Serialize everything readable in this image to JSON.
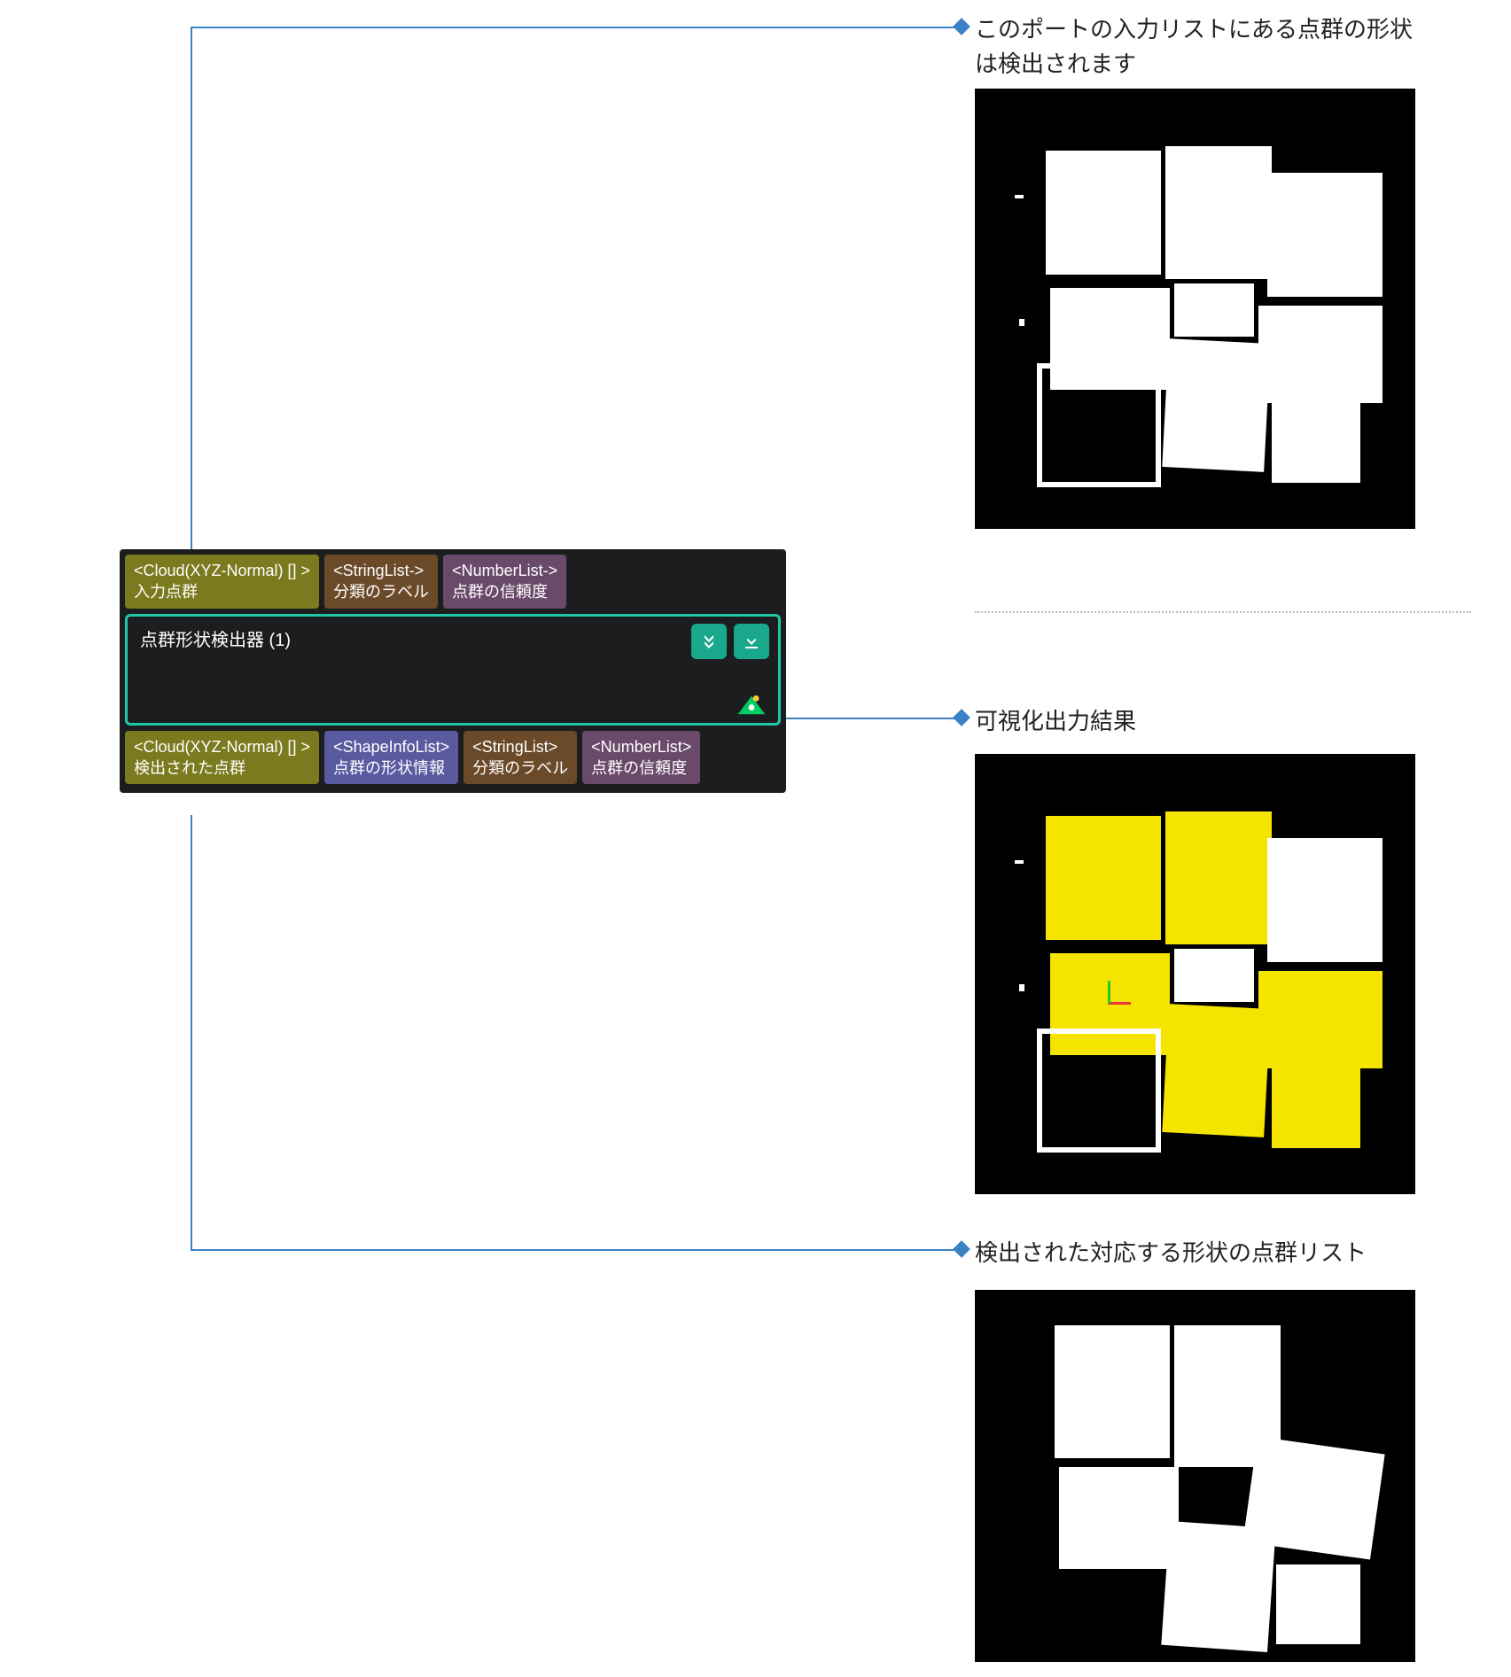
{
  "node": {
    "title": "点群形状検出器 (1)",
    "inputs": [
      {
        "type": "<Cloud(XYZ-Normal) [] >",
        "label": "入力点群",
        "color": "p-olive"
      },
      {
        "type": "<StringList->",
        "label": "分類のラベル",
        "color": "p-brown"
      },
      {
        "type": "<NumberList->",
        "label": "点群の信頼度",
        "color": "p-purple"
      }
    ],
    "outputs": [
      {
        "type": "<Cloud(XYZ-Normal) [] >",
        "label": "検出された点群",
        "color": "p-olive"
      },
      {
        "type": "<ShapeInfoList>",
        "label": "点群の形状情報",
        "color": "p-blue"
      },
      {
        "type": "<StringList>",
        "label": "分類のラベル",
        "color": "p-brown"
      },
      {
        "type": "<NumberList>",
        "label": "点群の信頼度",
        "color": "p-purple"
      }
    ],
    "icons": {
      "expand": "expand-icon",
      "download": "download-icon",
      "vis": "eye-icon"
    }
  },
  "callouts": {
    "c1": "このポートの入力リストにある点群の形状は検出されます",
    "c2": "可視化出力結果",
    "c3": "検出された対応する形状の点群リスト"
  },
  "colors": {
    "accent": "#3b82c4",
    "nodeBorder": "#1fc7a8"
  }
}
